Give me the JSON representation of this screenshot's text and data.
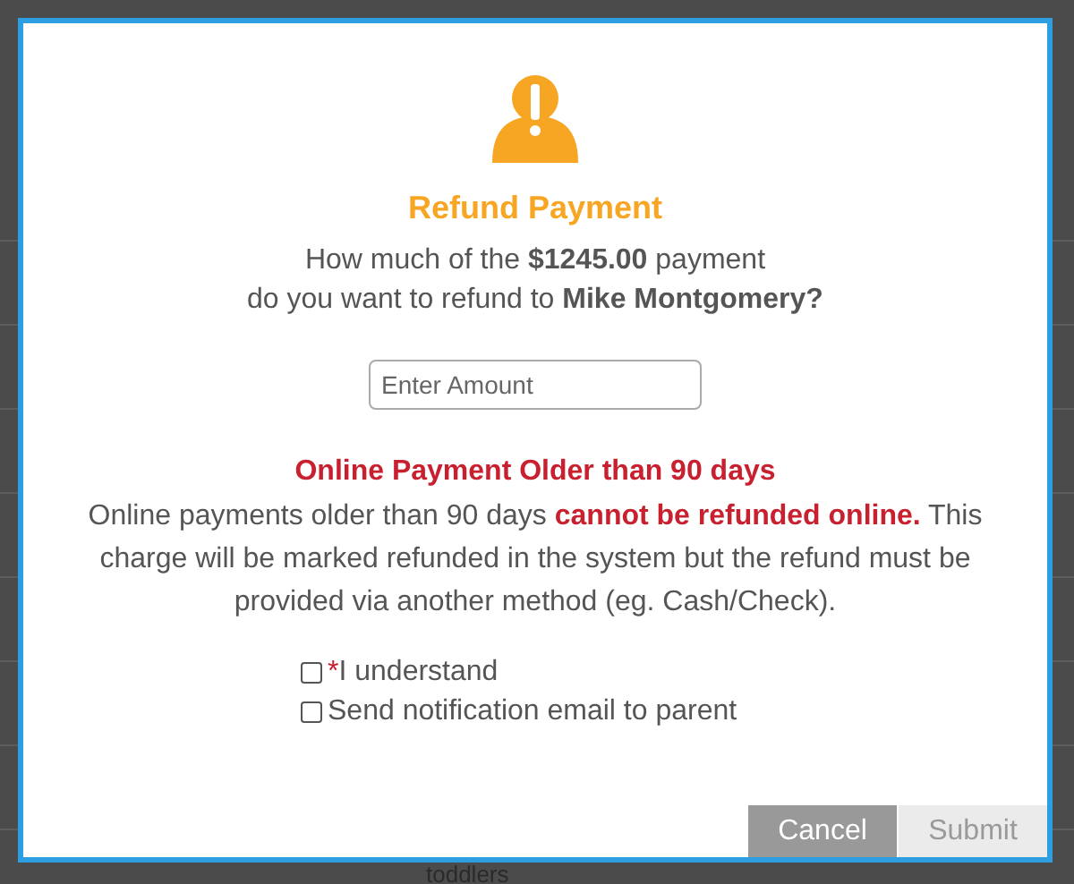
{
  "background": {
    "visible_text": "toddlers"
  },
  "dialog": {
    "title": "Refund Payment",
    "question": [
      "How much of the **$1245.00** payment",
      "do you want to refund to **Mike Montgomery?**"
    ],
    "amount_field": {
      "placeholder": "Enter Amount"
    },
    "warning_title": "Online Payment Older than 90 days",
    "warning": "Online payments older than 90 days **cannot be refunded online.** This charge will be marked refunded in the system but the refund must be provided via another method (eg. Cash/Check).",
    "checkboxes": [
      {
        "label": "I understand",
        "required_mark": "*",
        "checked": false
      },
      {
        "label": "Send notification email to parent",
        "checked": false
      }
    ],
    "buttons": [
      {
        "label": "Cancel",
        "disabled": false
      },
      {
        "label": "Submit",
        "disabled": true
      }
    ]
  }
}
